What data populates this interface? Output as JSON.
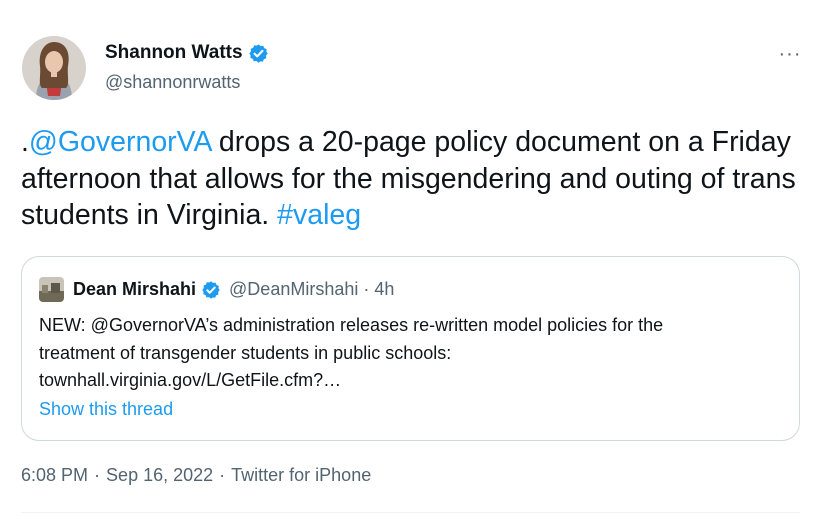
{
  "author": {
    "name": "Shannon Watts",
    "handle": "@shannonrwatts",
    "verified": true
  },
  "more_label": "···",
  "tweet": {
    "prefix": ".",
    "mention": "@GovernorVA",
    "body": " drops a 20-page policy document on a Friday afternoon that allows for the misgendering and outing of trans students in Virginia. ",
    "hashtag": "#valeg"
  },
  "quote": {
    "name": "Dean Mirshahi",
    "handle": "@DeanMirshahi",
    "dot": "·",
    "time": "4h",
    "lines": [
      "NEW: @GovernorVA’s administration releases re-written model policies for the",
      "treatment of transgender students in public schools:",
      "townhall.virginia.gov/L/GetFile.cfm?…"
    ],
    "show_thread": "Show this thread"
  },
  "meta": {
    "time": "6:08 PM",
    "sep1": "·",
    "date": "Sep 16, 2022",
    "sep2": "·",
    "source": "Twitter for iPhone"
  },
  "colors": {
    "link": "#1d9bf0",
    "secondary": "#536471",
    "border": "#cfd9de"
  }
}
